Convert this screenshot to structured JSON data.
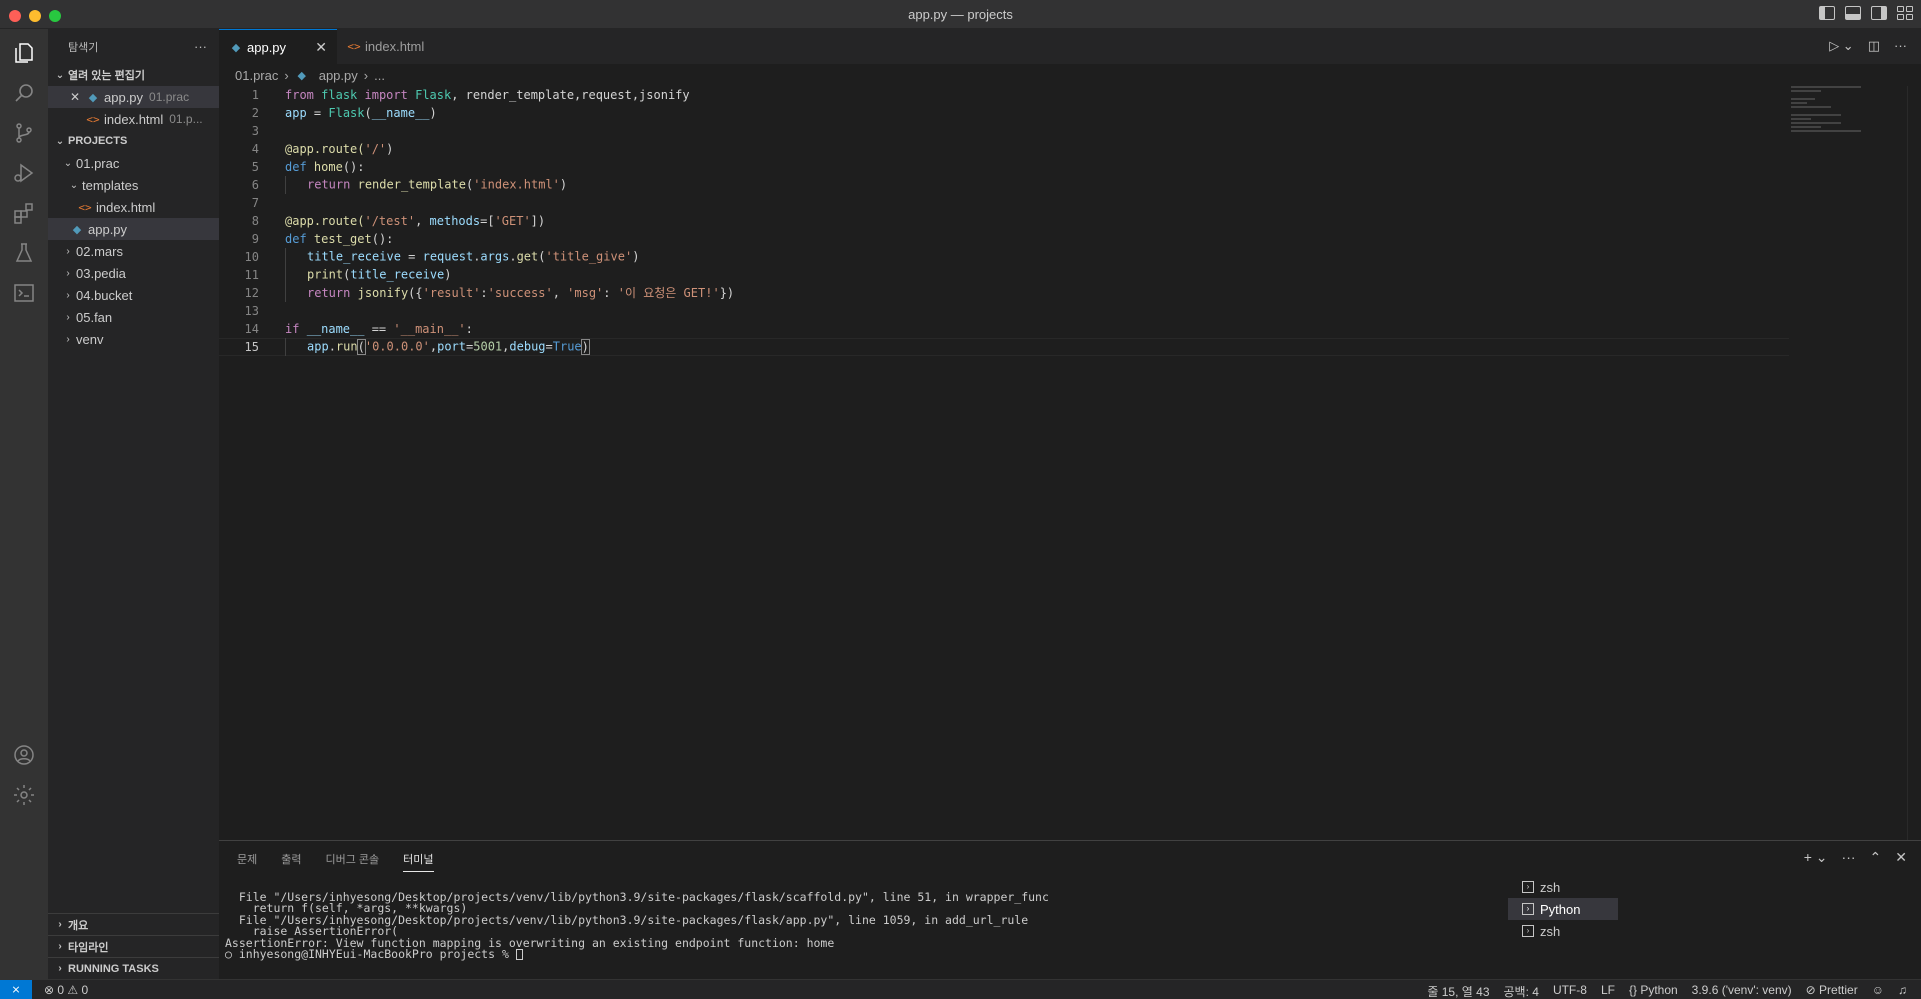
{
  "window": {
    "title": "app.py — projects"
  },
  "sidebar": {
    "header": "탐색기",
    "more": "···",
    "open_editors": {
      "title": "열려 있는 편집기",
      "items": [
        {
          "name": "app.py",
          "desc": "01.prac"
        },
        {
          "name": "index.html",
          "desc": "01.p..."
        }
      ]
    },
    "projects": {
      "title": "PROJECTS",
      "tree": [
        {
          "label": "01.prac"
        },
        {
          "label": "templates"
        },
        {
          "label": "index.html"
        },
        {
          "label": "app.py"
        },
        {
          "label": "02.mars"
        },
        {
          "label": "03.pedia"
        },
        {
          "label": "04.bucket"
        },
        {
          "label": "05.fan"
        },
        {
          "label": "venv"
        }
      ]
    },
    "bottom": [
      "개요",
      "타임라인",
      "RUNNING TASKS"
    ]
  },
  "tabs": [
    {
      "label": "app.py"
    },
    {
      "label": "index.html"
    }
  ],
  "breadcrumb": [
    "01.prac",
    "app.py",
    "..."
  ],
  "editor": {
    "line_numbers": [
      "1",
      "2",
      "3",
      "4",
      "5",
      "6",
      "7",
      "8",
      "9",
      "10",
      "11",
      "12",
      "13",
      "14",
      "15"
    ]
  },
  "code_tokens": {
    "l1": [
      "from",
      "flask",
      "import",
      "Flask",
      ", render_template,request,jsonify"
    ],
    "l2": [
      "app",
      " = ",
      "Flask",
      "(",
      "__name__",
      ")"
    ],
    "l4": [
      "@app.route(",
      "'/'",
      ")"
    ],
    "l5": [
      "def",
      " ",
      "home",
      "():"
    ],
    "l6": [
      "return",
      " ",
      "render_template",
      "(",
      "'index.html'",
      ")"
    ],
    "l8": [
      "@app.route(",
      "'/test'",
      ", ",
      "methods",
      "=[",
      "'GET'",
      "])"
    ],
    "l9": [
      "def",
      " ",
      "test_get",
      "():"
    ],
    "l10": [
      "title_receive",
      " = ",
      "request",
      ".",
      "args",
      ".",
      "get",
      "(",
      "'title_give'",
      ")"
    ],
    "l11": [
      "print",
      "(",
      "title_receive",
      ")"
    ],
    "l12": [
      "return",
      " ",
      "jsonify",
      "({",
      "'result'",
      ":",
      "'success'",
      ", ",
      "'msg'",
      ": ",
      "'이 요청은 GET!'",
      "})"
    ],
    "l14": [
      "if",
      " ",
      "__name__",
      " == ",
      "'__main__'",
      ":"
    ],
    "l15": [
      "app",
      ".",
      "run",
      "(",
      "'0.0.0.0'",
      ",",
      "port",
      "=",
      "5001",
      ",",
      "debug",
      "=",
      "True",
      ")"
    ]
  },
  "panel": {
    "tabs": [
      "문제",
      "출력",
      "디버그 콘솔",
      "터미널"
    ],
    "terminal_lines": [
      "  File \"/Users/inhyesong/Desktop/projects/venv/lib/python3.9/site-packages/flask/scaffold.py\", line 51, in wrapper_func",
      "    return f(self, *args, **kwargs)",
      "  File \"/Users/inhyesong/Desktop/projects/venv/lib/python3.9/site-packages/flask/app.py\", line 1059, in add_url_rule",
      "    raise AssertionError(",
      "AssertionError: View function mapping is overwriting an existing endpoint function: home"
    ],
    "prompt": "○ inhyesong@INHYEui-MacBookPro projects % ",
    "terminals": [
      "zsh",
      "Python",
      "zsh"
    ]
  },
  "statusbar": {
    "problems": "⊗ 0 ⚠ 0",
    "position": "줄 15, 열 43",
    "spaces": "공백: 4",
    "encoding": "UTF-8",
    "eol": "LF",
    "language": "Python",
    "interpreter": "3.9.6 ('venv': venv)",
    "formatter": "Prettier"
  }
}
